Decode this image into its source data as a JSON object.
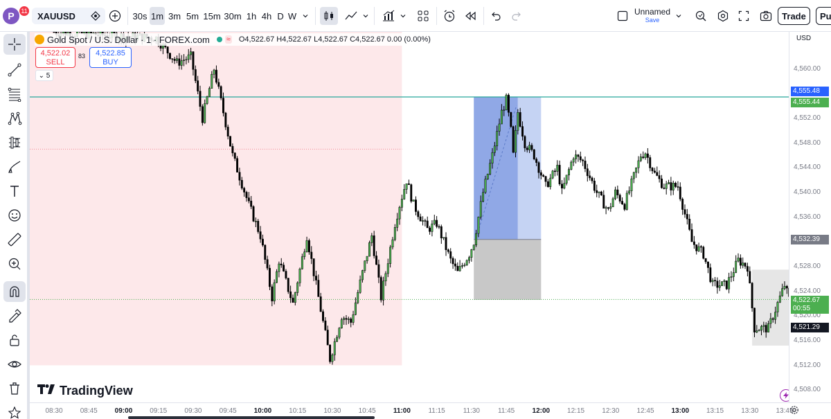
{
  "topbar": {
    "avatar_letter": "P",
    "notifications": "11",
    "symbol": "XAUUSD",
    "intervals": [
      "30s",
      "1m",
      "3m",
      "5m",
      "15m",
      "30m",
      "1h",
      "4h",
      "D",
      "W"
    ],
    "active_interval": "1m",
    "layout_name": "Unnamed",
    "layout_save": "Save",
    "trade_label": "Trade",
    "publish_label": "Pu"
  },
  "legend": {
    "title": "Gold Spot / U.S. Dollar · 1 · FOREX.com",
    "ohlc": "O4,522.67 H4,522.67 L4,522.67 C4,522.67 0.00 (0.00%)",
    "approx": "≈"
  },
  "order": {
    "sell_price": "4,522.02",
    "sell_label": "SELL",
    "spread": "83",
    "buy_price": "4,522.85",
    "buy_label": "BUY",
    "collapse_label": "⌄ 5"
  },
  "branding": "TradingView",
  "price_scale": {
    "currency": "USD",
    "labels": [
      "4,560.00",
      "4,556.00",
      "4,552.00",
      "4,548.00",
      "4,544.00",
      "4,540.00",
      "4,536.00",
      "4,532.00",
      "4,528.00",
      "4,524.00",
      "4,520.00",
      "4,516.00",
      "4,512.00",
      "4,508.00"
    ],
    "badges": {
      "line_high": "4,555.48",
      "line_green": "4,555.44",
      "grey": "4,532.39",
      "current": "4,522.67",
      "countdown": "00:55",
      "dark": "4,521.29"
    }
  },
  "time_scale": {
    "labels": [
      {
        "t": "08:30",
        "bold": false
      },
      {
        "t": "08:45",
        "bold": false
      },
      {
        "t": "09:00",
        "bold": true
      },
      {
        "t": "09:15",
        "bold": false
      },
      {
        "t": "09:30",
        "bold": false
      },
      {
        "t": "09:45",
        "bold": false
      },
      {
        "t": "10:00",
        "bold": true
      },
      {
        "t": "10:15",
        "bold": false
      },
      {
        "t": "10:30",
        "bold": false
      },
      {
        "t": "10:45",
        "bold": false
      },
      {
        "t": "11:00",
        "bold": true
      },
      {
        "t": "11:15",
        "bold": false
      },
      {
        "t": "11:30",
        "bold": false
      },
      {
        "t": "11:45",
        "bold": false
      },
      {
        "t": "12:00",
        "bold": true
      },
      {
        "t": "12:15",
        "bold": false
      },
      {
        "t": "12:30",
        "bold": false
      },
      {
        "t": "12:45",
        "bold": false
      },
      {
        "t": "13:00",
        "bold": true
      },
      {
        "t": "13:15",
        "bold": false
      },
      {
        "t": "13:30",
        "bold": false
      },
      {
        "t": "13:45",
        "bold": false
      }
    ]
  },
  "colors": {
    "up": "#4caf50",
    "down": "#000000",
    "hline": "#26a69a",
    "pink_zone": "#fde8ea",
    "blue_dark": "#90a8e6",
    "blue_light": "#c5d3f3",
    "grey_zone": "#c8c8c8",
    "grey_light": "#e6e6e6",
    "badge_blue": "#2962ff",
    "badge_green": "#4caf50",
    "badge_grey": "#787b86",
    "badge_dark": "#131722"
  },
  "drawings": {
    "hline_price": 4555.46,
    "current_price": 4522.67,
    "red_dotted_price": 4547.0,
    "pink_zone": {
      "t0": "08:30",
      "t1": "11:00",
      "p_top": 4566,
      "p_bot": 4512.0
    },
    "long_position": {
      "t0": "11:31",
      "t1": "12:00",
      "entry": 4532.39,
      "target": 4555.44,
      "stop": 4522.6,
      "split": "11:50"
    },
    "grey_box": {
      "t0": "13:31",
      "t1": "13:48",
      "p_top": 4527.5,
      "p_bot": 4515.2
    }
  },
  "chart_data": {
    "type": "candlestick",
    "symbol": "XAUUSD",
    "interval": "1m",
    "ylim": [
      4506,
      4566
    ],
    "x_range": [
      "08:26",
      "13:54"
    ],
    "path": [
      {
        "t": "08:30",
        "p": 4566
      },
      {
        "t": "09:15",
        "p": 4565
      },
      {
        "t": "09:24",
        "p": 4561
      },
      {
        "t": "09:30",
        "p": 4562
      },
      {
        "t": "09:35",
        "p": 4552
      },
      {
        "t": "09:40",
        "p": 4560
      },
      {
        "t": "09:48",
        "p": 4546
      },
      {
        "t": "09:55",
        "p": 4538
      },
      {
        "t": "10:00",
        "p": 4533
      },
      {
        "t": "10:05",
        "p": 4523
      },
      {
        "t": "10:08",
        "p": 4529
      },
      {
        "t": "10:14",
        "p": 4522
      },
      {
        "t": "10:20",
        "p": 4533
      },
      {
        "t": "10:24",
        "p": 4525
      },
      {
        "t": "10:30",
        "p": 4513
      },
      {
        "t": "10:35",
        "p": 4520
      },
      {
        "t": "10:39",
        "p": 4519
      },
      {
        "t": "10:44",
        "p": 4527
      },
      {
        "t": "10:48",
        "p": 4533
      },
      {
        "t": "10:52",
        "p": 4523
      },
      {
        "t": "10:58",
        "p": 4535
      },
      {
        "t": "11:00",
        "p": 4538
      },
      {
        "t": "11:03",
        "p": 4542
      },
      {
        "t": "11:06",
        "p": 4538
      },
      {
        "t": "11:12",
        "p": 4534
      },
      {
        "t": "11:16",
        "p": 4535
      },
      {
        "t": "11:22",
        "p": 4529
      },
      {
        "t": "11:25",
        "p": 4527
      },
      {
        "t": "11:30",
        "p": 4530
      },
      {
        "t": "11:32",
        "p": 4532
      },
      {
        "t": "11:36",
        "p": 4540
      },
      {
        "t": "11:40",
        "p": 4546
      },
      {
        "t": "11:44",
        "p": 4553
      },
      {
        "t": "11:46",
        "p": 4555
      },
      {
        "t": "11:48",
        "p": 4550
      },
      {
        "t": "11:49",
        "p": 4546
      },
      {
        "t": "11:51",
        "p": 4553
      },
      {
        "t": "11:54",
        "p": 4548
      },
      {
        "t": "11:58",
        "p": 4546
      },
      {
        "t": "12:03",
        "p": 4541
      },
      {
        "t": "12:08",
        "p": 4544
      },
      {
        "t": "12:10",
        "p": 4540
      },
      {
        "t": "12:15",
        "p": 4546
      },
      {
        "t": "12:19",
        "p": 4545
      },
      {
        "t": "12:25",
        "p": 4540
      },
      {
        "t": "12:30",
        "p": 4537
      },
      {
        "t": "12:33",
        "p": 4540
      },
      {
        "t": "12:37",
        "p": 4538
      },
      {
        "t": "12:44",
        "p": 4546
      },
      {
        "t": "12:46",
        "p": 4546.5
      },
      {
        "t": "12:50",
        "p": 4543
      },
      {
        "t": "12:54",
        "p": 4541
      },
      {
        "t": "13:00",
        "p": 4541
      },
      {
        "t": "13:06",
        "p": 4532
      },
      {
        "t": "13:11",
        "p": 4530
      },
      {
        "t": "13:15",
        "p": 4525
      },
      {
        "t": "13:21",
        "p": 4525
      },
      {
        "t": "13:26",
        "p": 4529
      },
      {
        "t": "13:30",
        "p": 4528
      },
      {
        "t": "13:33",
        "p": 4518
      },
      {
        "t": "13:39",
        "p": 4518
      },
      {
        "t": "13:43",
        "p": 4522
      },
      {
        "t": "13:46",
        "p": 4525
      },
      {
        "t": "13:48",
        "p": 4522.7
      }
    ],
    "seed": 7
  }
}
